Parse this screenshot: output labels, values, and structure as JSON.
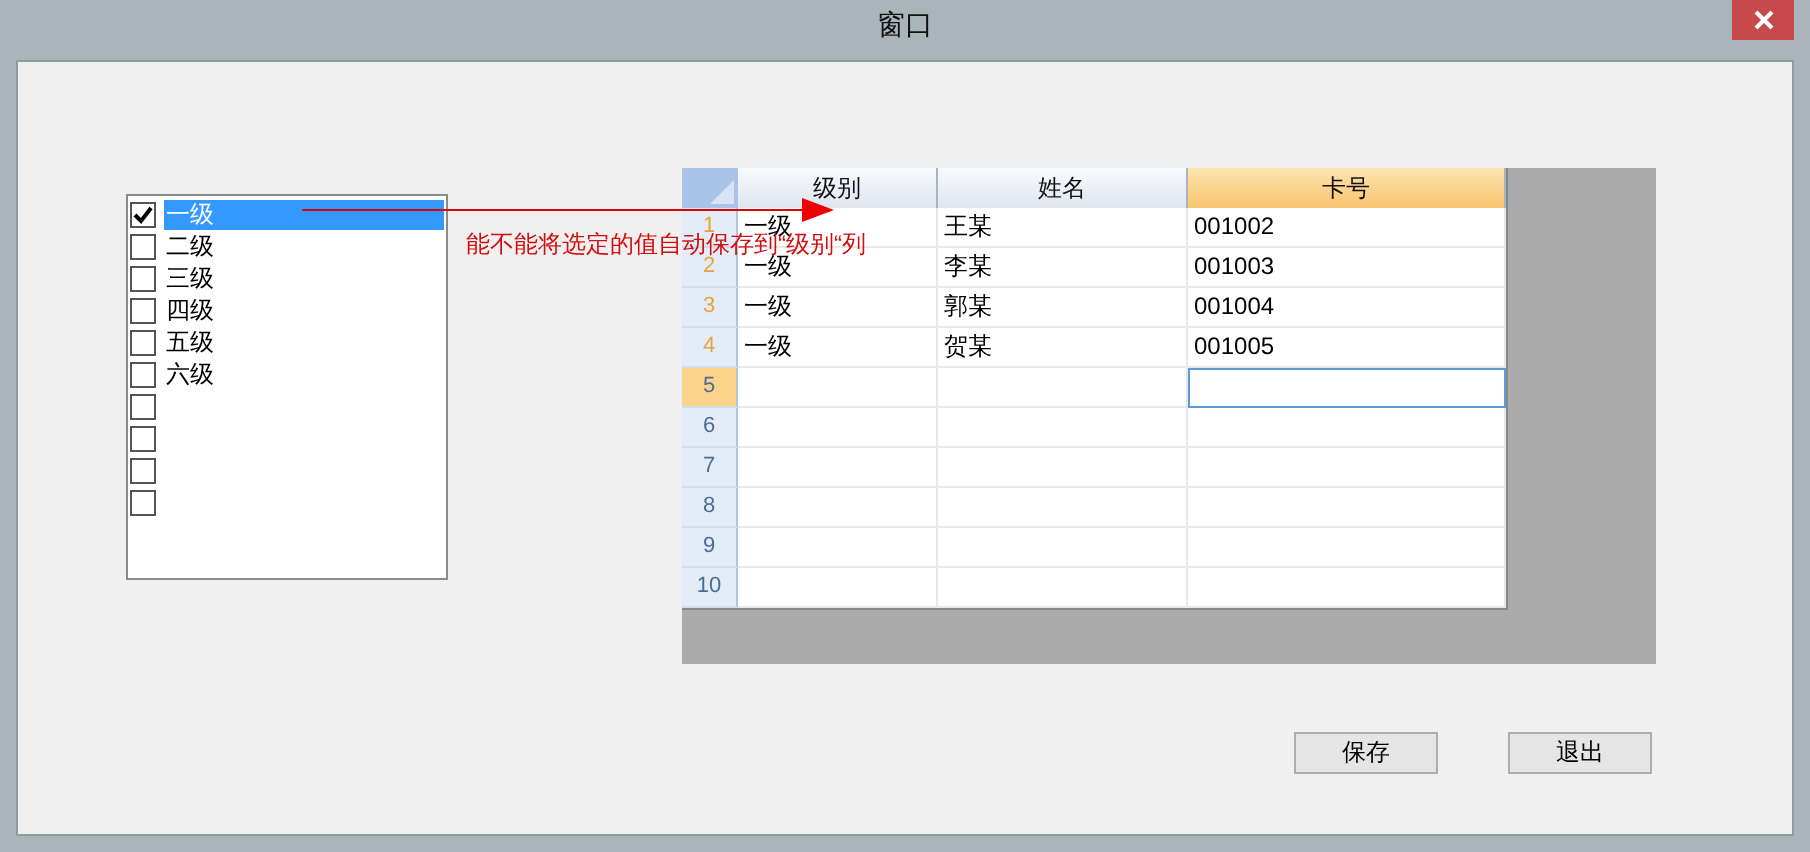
{
  "window": {
    "title": "窗口"
  },
  "checklist": [
    {
      "label": "一级",
      "checked": true,
      "selected": true
    },
    {
      "label": "二级",
      "checked": false,
      "selected": false
    },
    {
      "label": "三级",
      "checked": false,
      "selected": false
    },
    {
      "label": "四级",
      "checked": false,
      "selected": false
    },
    {
      "label": "五级",
      "checked": false,
      "selected": false
    },
    {
      "label": "六级",
      "checked": false,
      "selected": false
    },
    {
      "checked": false,
      "selected": false
    },
    {
      "checked": false,
      "selected": false
    },
    {
      "checked": false,
      "selected": false
    },
    {
      "checked": false,
      "selected": false
    }
  ],
  "annotation": "能不能将选定的值自动保存到“级别“列",
  "grid": {
    "columns": [
      {
        "label": "级别",
        "selected": false
      },
      {
        "label": "姓名",
        "selected": false
      },
      {
        "label": "卡号",
        "selected": true
      }
    ],
    "rows": [
      {
        "number": "1",
        "selected": false,
        "cells": [
          "一级",
          "王某",
          "001002"
        ]
      },
      {
        "number": "2",
        "selected": false,
        "cells": [
          "一级",
          "李某",
          "001003"
        ]
      },
      {
        "number": "3",
        "selected": false,
        "cells": [
          "一级",
          "郭某",
          "001004"
        ]
      },
      {
        "number": "4",
        "selected": false,
        "cells": [
          "一级",
          "贺某",
          "001005"
        ]
      },
      {
        "number": "5",
        "selected": true,
        "cells": []
      },
      {
        "number": "6",
        "selected": false,
        "cells": []
      },
      {
        "number": "7",
        "selected": false,
        "cells": []
      },
      {
        "number": "8",
        "selected": false,
        "cells": []
      },
      {
        "number": "9",
        "selected": false,
        "cells": []
      },
      {
        "number": "10",
        "selected": false,
        "cells": []
      }
    ]
  },
  "buttons": [
    "保存",
    "退出"
  ]
}
